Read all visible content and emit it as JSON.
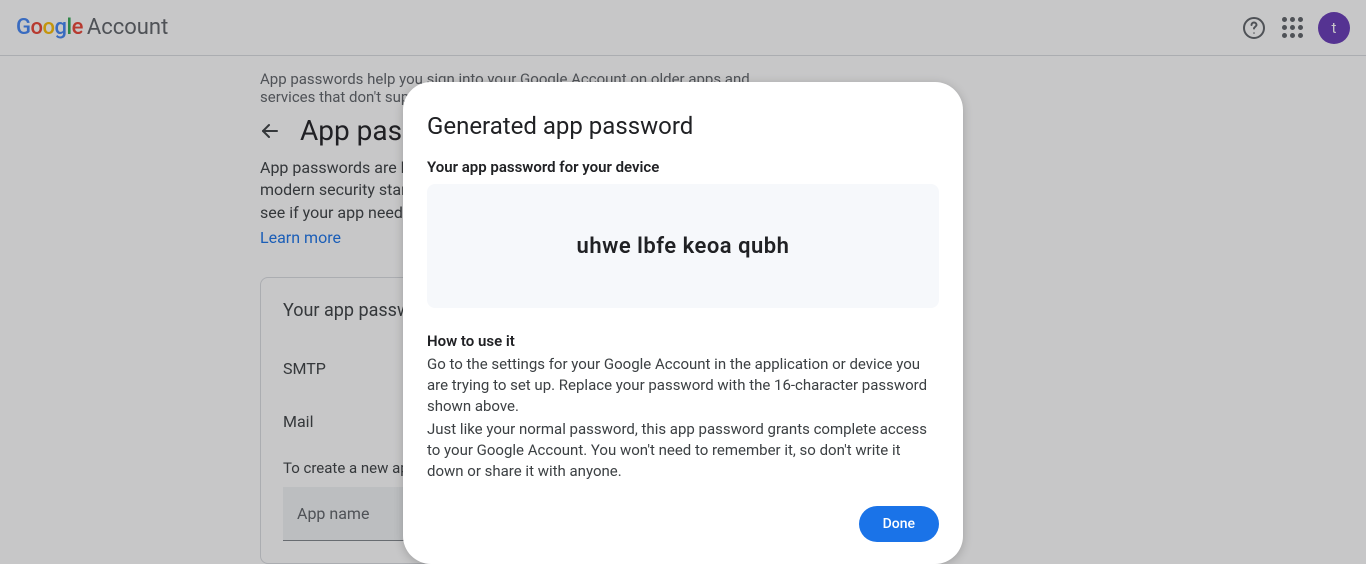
{
  "header": {
    "brand": "Google",
    "product": "Account",
    "avatar_initial": "t"
  },
  "page": {
    "intro": "App passwords help you sign into your Google Account on older apps and services that don't support modern security standards.",
    "title": "App passwords",
    "description": "App passwords are less secure than using up-to-date apps and services that use modern security standards. Before you create an app password, you should check to see if your app needs this.",
    "learn_more": "Learn more"
  },
  "card": {
    "title": "Your app passwords",
    "items": [
      "SMTP",
      "Mail"
    ],
    "create_label": "To create a new app specific password, type a name for it below...",
    "input_placeholder": "App name"
  },
  "modal": {
    "title": "Generated app password",
    "subtitle": "Your app password for your device",
    "password": "uhwe lbfe keoa qubh",
    "howto_title": "How to use it",
    "howto_p1": "Go to the settings for your Google Account in the application or device you are trying to set up. Replace your password with the 16-character password shown above.",
    "howto_p2": "Just like your normal password, this app password grants complete access to your Google Account. You won't need to remember it, so don't write it down or share it with anyone.",
    "done_label": "Done"
  }
}
